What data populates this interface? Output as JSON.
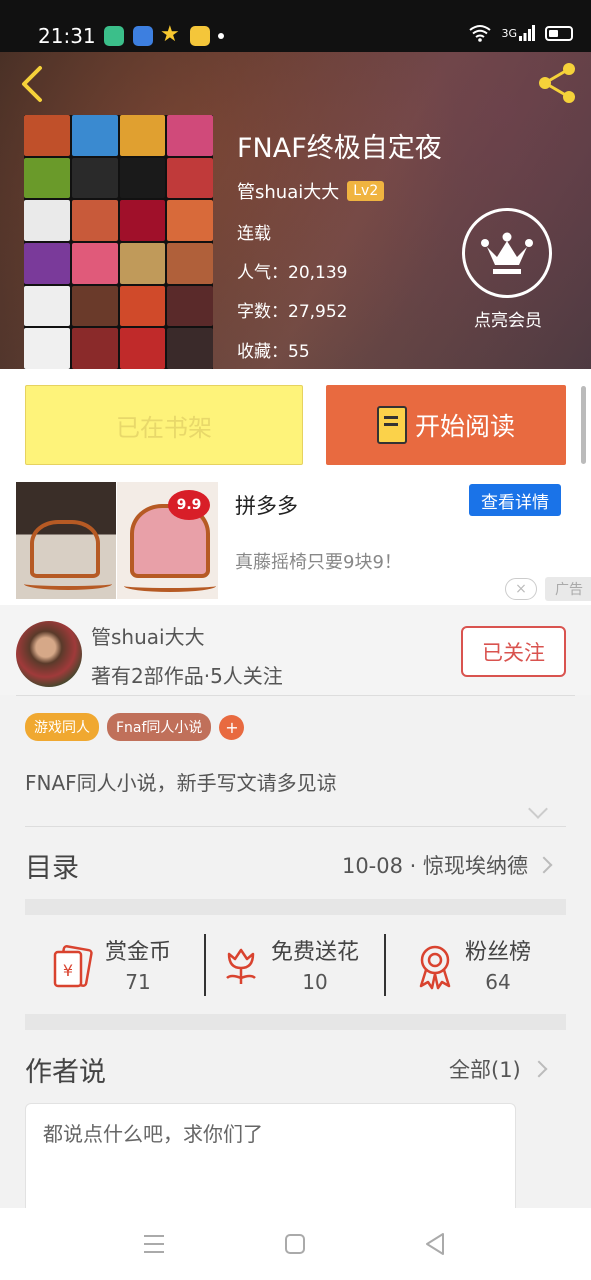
{
  "status_bar": {
    "time": "21:31",
    "network": "3G"
  },
  "book": {
    "title": "FNAF终极自定夜",
    "author": "管shuai大大",
    "level": "Lv2",
    "state": "连载",
    "popularity": "人气：20,139",
    "words": "字数：27,952",
    "favorites": "收藏：55",
    "vip_label": "点亮会员"
  },
  "actions": {
    "shelf_label": "已在书架",
    "read_label": "开始阅读"
  },
  "ad": {
    "title": "拼多多",
    "desc": "真藤摇椅只要9块9！",
    "button": "查看详情",
    "price_badge": "9.9",
    "label": "广告",
    "close": "×"
  },
  "author_card": {
    "name": "管shuai大大",
    "stats": "著有2部作品·5人关注",
    "follow_label": "已关注"
  },
  "tags": [
    {
      "label": "游戏同人",
      "color": "#f0a830"
    },
    {
      "label": "Fnaf同人小说",
      "color": "#c0705a"
    }
  ],
  "tag_add": "+",
  "description": "FNAF同人小说，新手写文请多见谅",
  "toc": {
    "label": "目录",
    "latest": "10-08 · 惊现埃纳德"
  },
  "stats": [
    {
      "label": "赏金币",
      "value": "71",
      "icon": "red-envelope-icon"
    },
    {
      "label": "免费送花",
      "value": "10",
      "icon": "flower-icon"
    },
    {
      "label": "粉丝榜",
      "value": "64",
      "icon": "medal-icon"
    }
  ],
  "author_say": {
    "title": "作者说",
    "all": "全部(1)",
    "placeholder": "都说点什么吧，求你们了"
  },
  "colors": {
    "accent": "#e86a40",
    "shelf": "#fef37a",
    "follow": "#d9534f",
    "ad_button": "#1a73e8"
  }
}
